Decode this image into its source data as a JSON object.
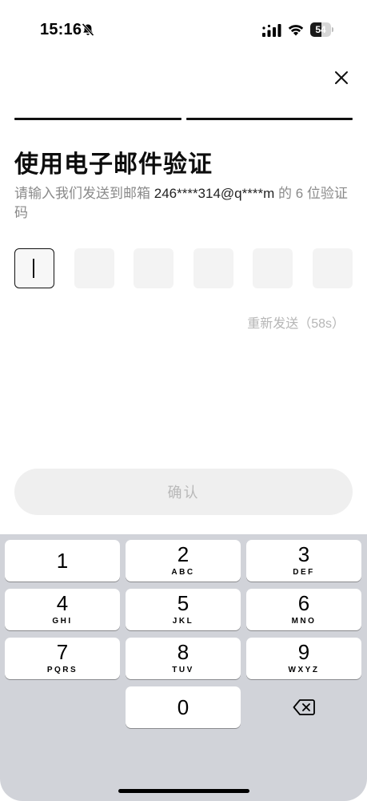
{
  "status_bar": {
    "time": "15:16",
    "battery_level": "54",
    "battery_fraction": 0.54,
    "icons": [
      "bell-muted-icon",
      "cellular-signal-icon",
      "wifi-icon",
      "battery-icon"
    ]
  },
  "header": {
    "close_icon": "close-icon",
    "progress_steps": 2,
    "progress_completed": 2
  },
  "main": {
    "title": "使用电子邮件验证",
    "subtitle_prefix": "请输入我们发送到邮箱 ",
    "email": "246****314@q****m",
    "subtitle_suffix": " 的 6 位验证码",
    "code_length": 6,
    "code_values": [
      "",
      "",
      "",
      "",
      "",
      ""
    ],
    "resend": "重新发送（58s）",
    "confirm": "确认"
  },
  "keyboard": {
    "keys": [
      {
        "digit": "1",
        "letters": ""
      },
      {
        "digit": "2",
        "letters": "ABC"
      },
      {
        "digit": "3",
        "letters": "DEF"
      },
      {
        "digit": "4",
        "letters": "GHI"
      },
      {
        "digit": "5",
        "letters": "JKL"
      },
      {
        "digit": "6",
        "letters": "MNO"
      },
      {
        "digit": "7",
        "letters": "PQRS"
      },
      {
        "digit": "8",
        "letters": "TUV"
      },
      {
        "digit": "9",
        "letters": "WXYZ"
      },
      {
        "digit": "0",
        "letters": ""
      }
    ],
    "delete_icon": "backspace-icon"
  },
  "colors": {
    "keyboard_bg": "#d1d3d9",
    "muted_text": "#8a8a8a",
    "disabled_button": "#efefef"
  }
}
